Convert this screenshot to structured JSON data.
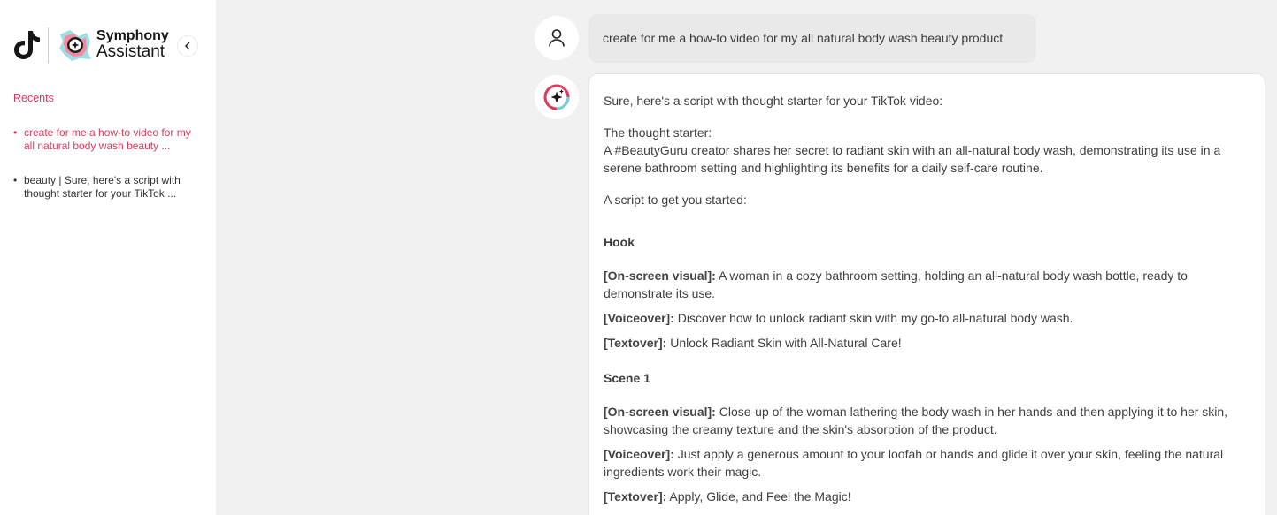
{
  "sidebar": {
    "brand": {
      "title_line1": "Symphony",
      "title_line2": "Assistant"
    },
    "recents_label": "Recents",
    "recents": [
      {
        "text": "create for me a how-to video for my all natural body wash beauty ..."
      },
      {
        "text": "beauty |  Sure, here's a script with thought starter for your TikTok ..."
      }
    ]
  },
  "chat": {
    "user_message": "create for me a how-to video for my all natural body wash beauty product",
    "response": {
      "intro": "Sure, here's a script with thought starter for your TikTok video:",
      "thought_label": "The thought starter:",
      "thought_text": "A #BeautyGuru creator shares her secret to radiant skin with an all-natural body wash, demonstrating its use in a serene bathroom setting and highlighting its benefits for a daily self-care routine.",
      "script_intro": "A script to get you started:",
      "hook": {
        "title": "Hook",
        "visual_label": "[On-screen visual]:",
        "visual_text": " A woman in a cozy bathroom setting, holding an all-natural body wash bottle, ready to demonstrate its use.",
        "voiceover_label": "[Voiceover]:",
        "voiceover_text": " Discover how to unlock radiant skin with my go-to all-natural body wash.",
        "textover_label": "[Textover]:",
        "textover_text": " Unlock Radiant Skin with All-Natural Care!"
      },
      "scene1": {
        "title": "Scene 1",
        "visual_label": "[On-screen visual]:",
        "visual_text": " Close-up of the woman lathering the body wash in her hands and then applying it to her skin, showcasing the creamy texture and the skin's absorption of the product.",
        "voiceover_label": "[Voiceover]:",
        "voiceover_text": " Just apply a generous amount to your loofah or hands and glide it over your skin, feeling the natural ingredients work their magic.",
        "textover_label": "[Textover]:",
        "textover_text": " Apply, Glide, and Feel the Magic!"
      }
    }
  },
  "icons": {
    "tiktok": "tiktok-logo-icon",
    "symphony": "symphony-logo-icon",
    "collapse": "chevron-left-icon",
    "user": "user-icon",
    "assistant": "sparkle-icon"
  },
  "colors": {
    "accent": "#e0375b",
    "background": "#f1f1f1",
    "bubble": "#e9e9e9"
  }
}
